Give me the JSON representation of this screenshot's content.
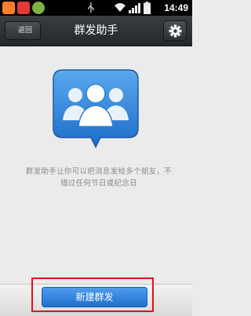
{
  "status_bar": {
    "time": "14:49",
    "icons": [
      "app-icon-1",
      "app-icon-2",
      "app-icon-3",
      "usb-icon",
      "wifi-icon",
      "signal-icon",
      "battery-icon"
    ]
  },
  "header": {
    "back_label": "返回",
    "title": "群发助手",
    "settings_icon": "gear-icon"
  },
  "main": {
    "illustration_icon": "group-chat-icon",
    "description": "群发助手让你可以把消息发给多个朋友，不错过任何节日或纪念日"
  },
  "footer": {
    "new_group_send_label": "新建群发"
  },
  "colors": {
    "title_bar": "#2c3033",
    "primary_button": "#2f82e0",
    "illustration_blue": "#3a8fe0",
    "highlight": "#e0131b"
  }
}
